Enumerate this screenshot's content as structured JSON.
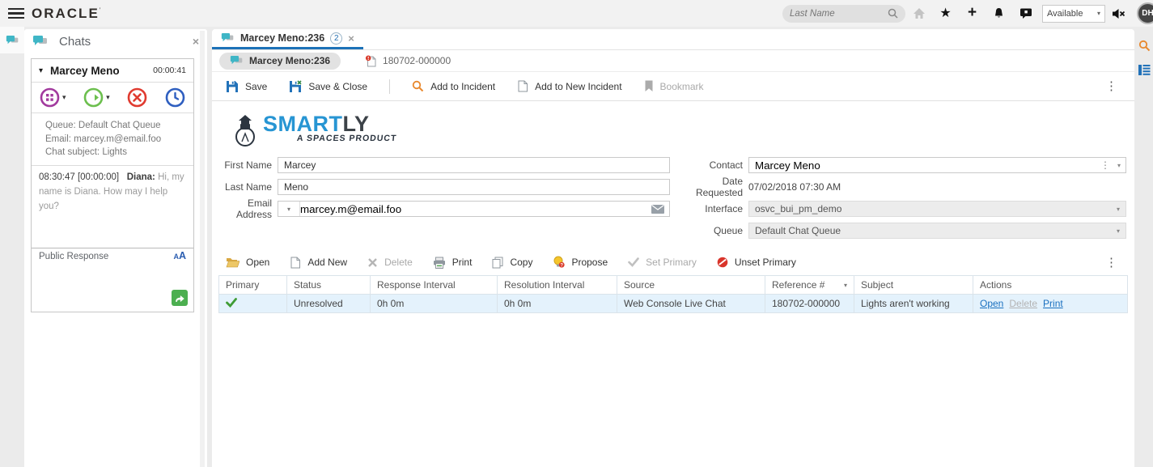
{
  "colors": {
    "accent_blue": "#1d72b8",
    "teal": "#3fb6c6",
    "link_blue": "#1a70c0",
    "selected_row": "#e4f2fc",
    "green_check": "#3f9c35",
    "red": "#d9352b",
    "purple": "#a23a9e",
    "transfer_green": "#6cbf4e",
    "clock_blue": "#2f5fc0",
    "orange": "#e8882d",
    "smartly_blue": "#2795d3",
    "send_green": "#4caf50"
  },
  "icons": {
    "caret_down": "▾",
    "kebab": "⋮",
    "close": "×",
    "star": "★",
    "plus": "+"
  },
  "topbar": {
    "brand": "ORACLE",
    "brand_mark": "’",
    "search_placeholder": "Last Name",
    "availability": "Available",
    "avatar": "DH"
  },
  "chat_panel": {
    "title": "Chats",
    "name": "Marcey Meno",
    "timer": "00:00:41",
    "info_line1": "Queue: Default Chat Queue",
    "info_line2": "Email: marcey.m@email.foo",
    "info_line3": "Chat subject: Lights",
    "message_meta": "08:30:47 [00:00:00]",
    "message_sender": "Diana:",
    "message_text": "Hi, my name is Diana. How may I help you?",
    "response_label": "Public Response",
    "font_small": "A",
    "font_large": "A"
  },
  "main": {
    "tab_label": "Marcey Meno:236",
    "tab_badge": "2",
    "subtab_contact": "Marcey Meno:236",
    "subtab_incident": "180702-000000",
    "toolbar": {
      "save": "Save",
      "save_close": "Save & Close",
      "add_to_incident": "Add to Incident",
      "add_to_new_incident": "Add to New Incident",
      "bookmark": "Bookmark"
    },
    "logo": {
      "smart": "SMART",
      "ly": "LY",
      "tagline": "A SPACES PRODUCT"
    },
    "form": {
      "first_name_label": "First Name",
      "first_name_value": "Marcey",
      "last_name_label": "Last Name",
      "last_name_value": "Meno",
      "email_label": "Email Address",
      "email_value": "marcey.m@email.foo",
      "contact_label": "Contact",
      "contact_value": "Marcey Meno",
      "date_label": "Date Requested",
      "date_value": "07/02/2018 07:30 AM",
      "interface_label": "Interface",
      "interface_value": "osvc_bui_pm_demo",
      "queue_label": "Queue",
      "queue_value": "Default Chat Queue"
    },
    "incident_toolbar": {
      "open": "Open",
      "add_new": "Add New",
      "delete": "Delete",
      "print": "Print",
      "copy": "Copy",
      "propose": "Propose",
      "set_primary": "Set Primary",
      "unset_primary": "Unset Primary"
    },
    "table": {
      "headers": [
        "Primary",
        "Status",
        "Response Interval",
        "Resolution Interval",
        "Source",
        "Reference #",
        "Subject",
        "Actions"
      ],
      "row": {
        "status": "Unresolved",
        "response_interval": "0h 0m",
        "resolution_interval": "0h 0m",
        "source": "Web Console Live Chat",
        "reference": "180702-000000",
        "subject": "Lights aren't working",
        "action_open": "Open",
        "action_delete": "Delete",
        "action_print": "Print"
      }
    }
  }
}
